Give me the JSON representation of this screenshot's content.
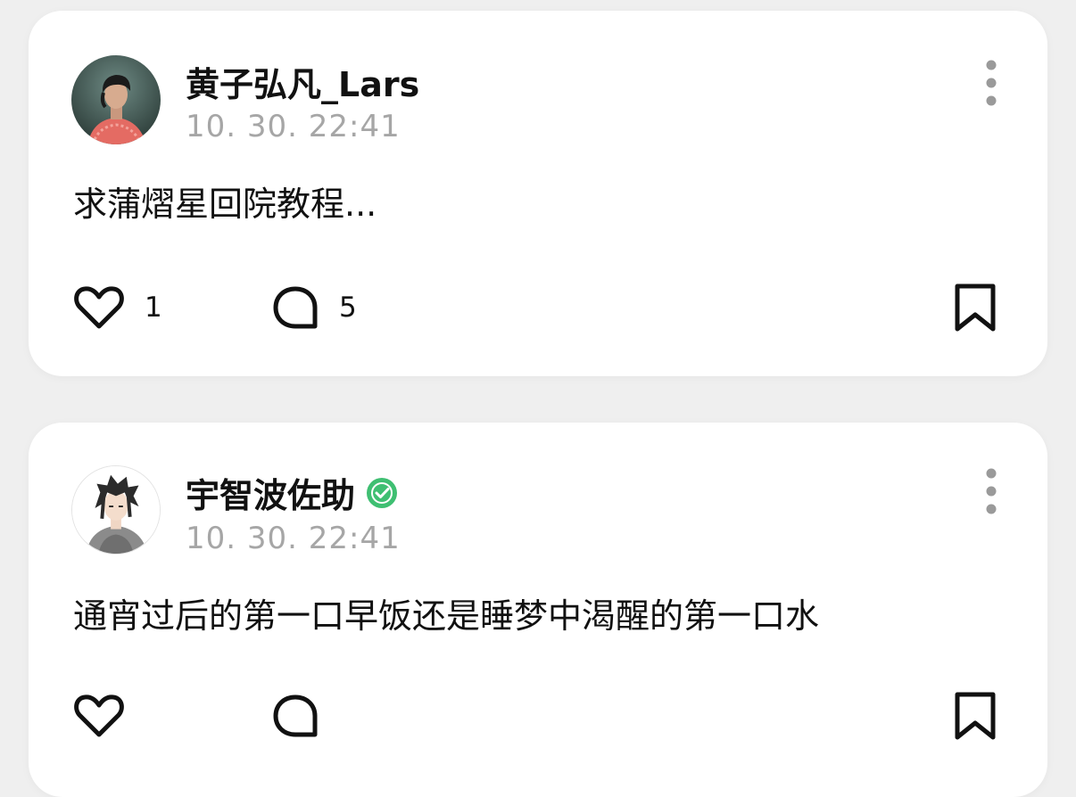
{
  "posts": [
    {
      "username": "黄子弘凡_Lars",
      "timestamp": "10. 30. 22:41",
      "text": "求蒲熠星回院教程...",
      "likes": "1",
      "comments": "5",
      "verified": false
    },
    {
      "username": "宇智波佐助",
      "timestamp": "10. 30. 22:41",
      "text": "通宵过后的第一口早饭还是睡梦中渴醒的第一口水",
      "likes": "",
      "comments": "",
      "verified": true
    }
  ],
  "icons": {
    "more": "more-vertical-icon",
    "like": "heart-icon",
    "comment": "comment-bubble-icon",
    "bookmark": "bookmark-icon",
    "verified": "verified-badge-icon"
  },
  "colors": {
    "background": "#efefef",
    "card": "#ffffff",
    "timestamp": "#a6a6a6",
    "verified": "#3fbf72"
  }
}
